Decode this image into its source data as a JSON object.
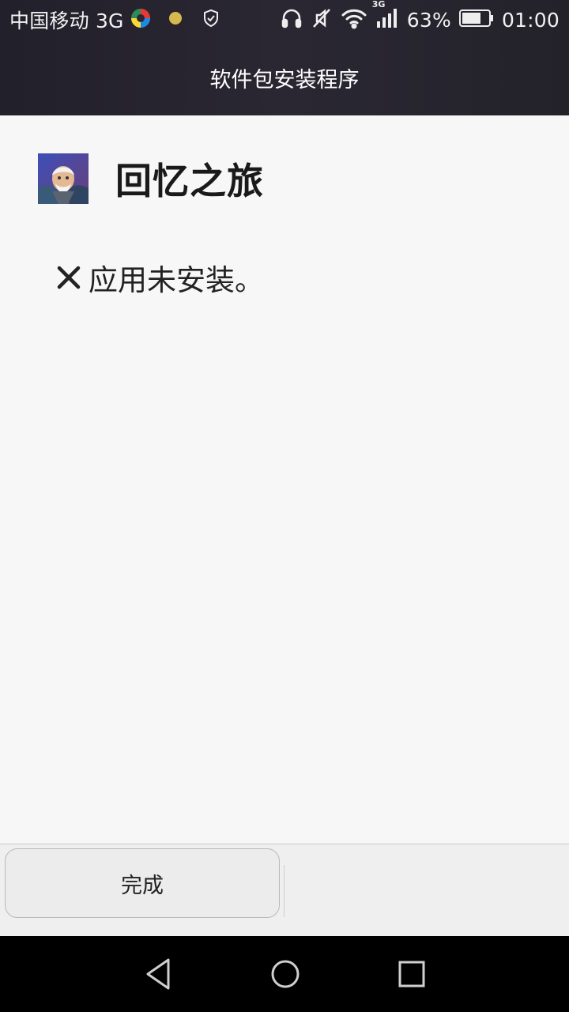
{
  "status_bar": {
    "carrier": "中国移动 3G",
    "network_badge": "3G",
    "battery": "63%",
    "time": "01:00",
    "icons": [
      "app-color-icon",
      "notification-dot-icon",
      "shield-icon",
      "headphones-icon",
      "mute-icon",
      "wifi-icon",
      "signal-icon",
      "battery-icon"
    ]
  },
  "header": {
    "title": "软件包安装程序"
  },
  "app": {
    "name": "回忆之旅",
    "icon": "app-icon"
  },
  "result": {
    "message": "应用未安装。",
    "icon": "x-icon"
  },
  "footer": {
    "done_label": "完成"
  },
  "nav": {
    "icons": [
      "back-icon",
      "home-icon",
      "recents-icon"
    ]
  },
  "colors": {
    "header_bg": "#26242c",
    "content_bg": "#f7f7f7",
    "button_bar_bg": "#efefef",
    "nav_bg": "#000000",
    "accent_dot": "#d6b94e"
  }
}
